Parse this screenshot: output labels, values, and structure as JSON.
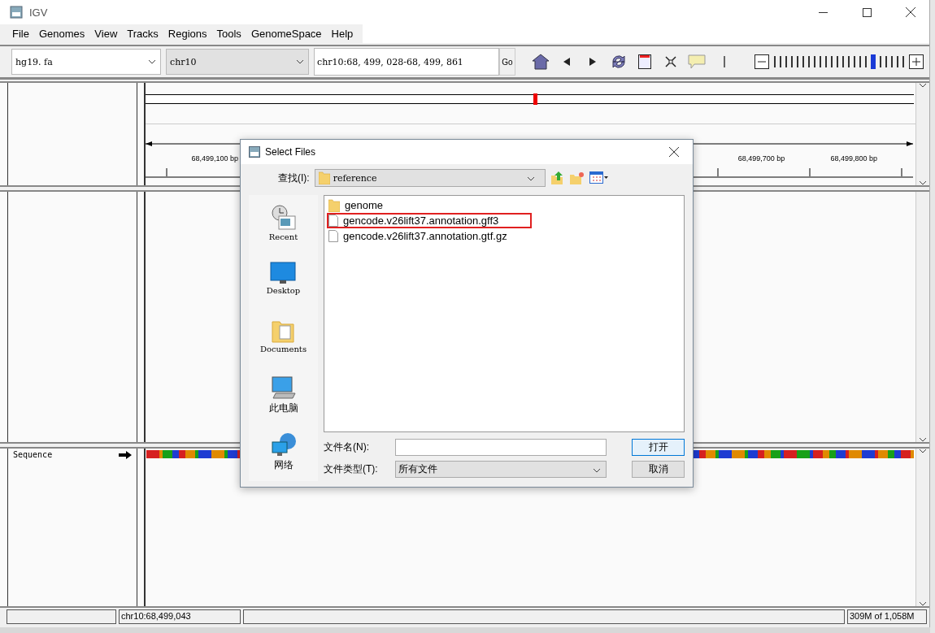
{
  "window": {
    "title": "IGV"
  },
  "menu": [
    "File",
    "Genomes",
    "View",
    "Tracks",
    "Regions",
    "Tools",
    "GenomeSpace",
    "Help"
  ],
  "toolbar": {
    "genome": "hg19. fa",
    "chromosome": "chr10",
    "locus": "chr10:68, 499, 028-68, 499, 861",
    "go": "Go",
    "zoom": {
      "level": 0.78
    }
  },
  "header_panel": {
    "ruler_labels": [
      "68,499,100 bp",
      "68,499,700 bp",
      "68,499,800 bp"
    ],
    "ideogram": {
      "level": 0.505
    }
  },
  "feature_panel": {
    "track_name": "Sequence"
  },
  "status_bar": {
    "position": "chr10:68,499,043",
    "memory": "309M of 1,058M"
  },
  "dialog": {
    "title": "Select Files",
    "look_in_label": "查找(I):",
    "look_in": "reference",
    "places": [
      {
        "label": "Recent",
        "kind": "recent"
      },
      {
        "label": "Desktop",
        "kind": "desktop"
      },
      {
        "label": "Documents",
        "kind": "documents"
      },
      {
        "label": "此电脑",
        "kind": "computer"
      },
      {
        "label": "网络",
        "kind": "network"
      }
    ],
    "files": [
      {
        "name": "genome",
        "kind": "folder",
        "marked": false
      },
      {
        "name": "gencode.v26lift37.annotation.gff3",
        "kind": "file",
        "marked": true
      },
      {
        "name": "gencode.v26lift37.annotation.gtf.gz",
        "kind": "file",
        "marked": false
      }
    ],
    "file_name_label": "文件名(N):",
    "file_type_label": "文件类型(T):",
    "file_type": "所有文件",
    "open": "打开",
    "cancel": "取消"
  }
}
